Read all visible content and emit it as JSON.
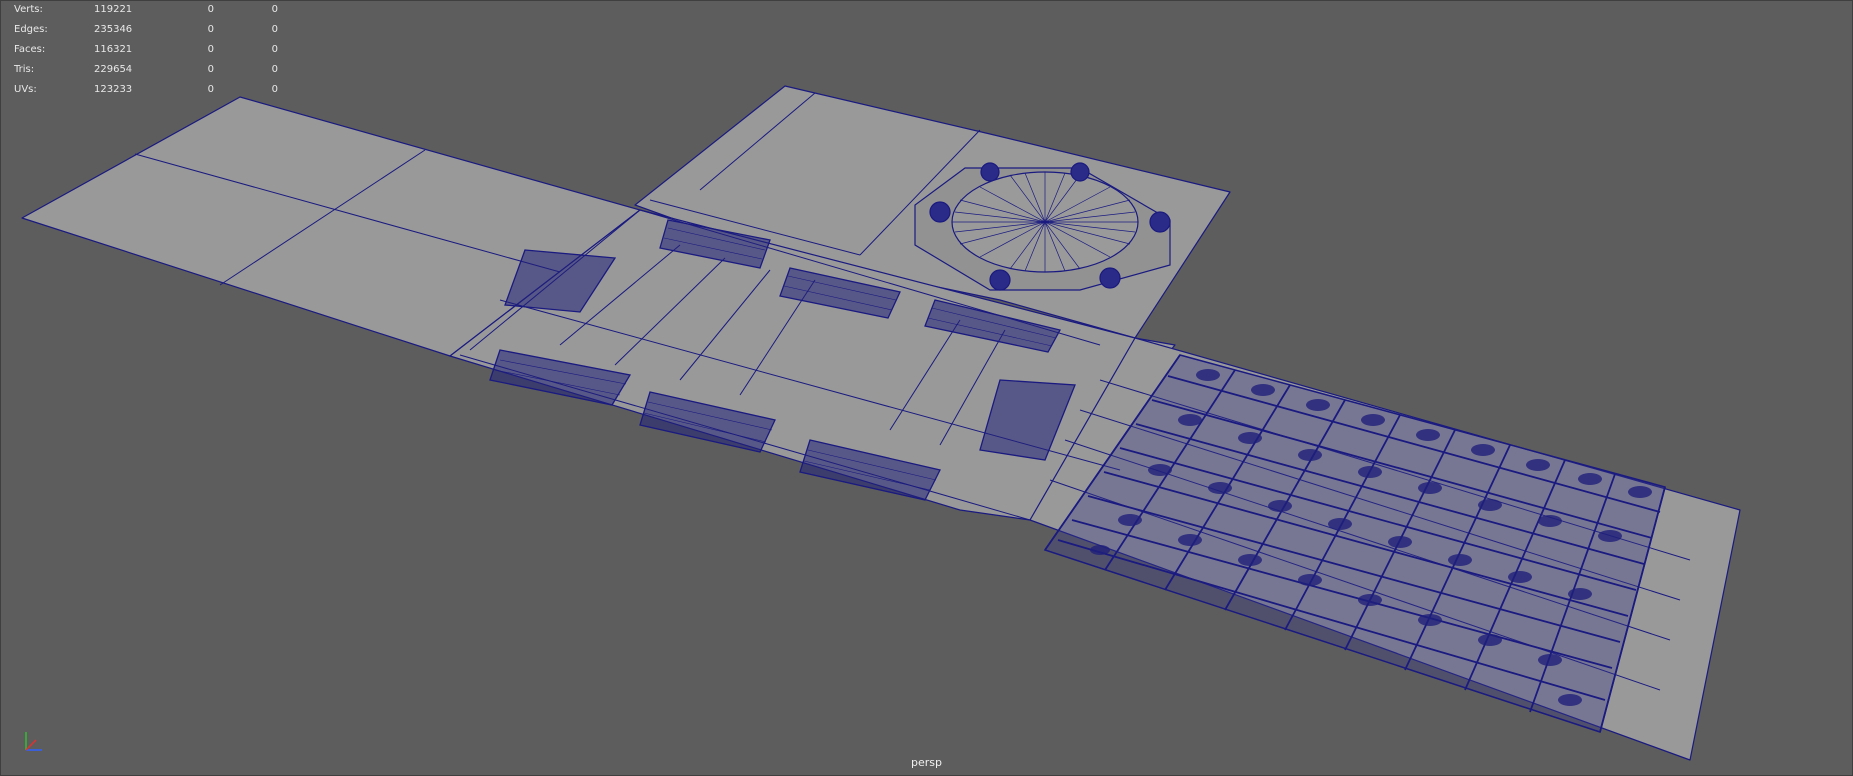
{
  "hud": {
    "rows": [
      {
        "label": "Verts:",
        "total": "119221",
        "selected": "0",
        "selected_components": "0"
      },
      {
        "label": "Edges:",
        "total": "235346",
        "selected": "0",
        "selected_components": "0"
      },
      {
        "label": "Faces:",
        "total": "116321",
        "selected": "0",
        "selected_components": "0"
      },
      {
        "label": "Tris:",
        "total": "229654",
        "selected": "0",
        "selected_components": "0"
      },
      {
        "label": "UVs:",
        "total": "123233",
        "selected": "0",
        "selected_components": "0"
      }
    ]
  },
  "viewport": {
    "camera": "persp",
    "background_color": "#5d5d5d",
    "mesh_fill_color": "#999999",
    "wireframe_color": "#1a1a80"
  },
  "axis_gizmo": {
    "x_color": "#e03030",
    "y_color": "#30c030",
    "z_color": "#3060ff"
  }
}
